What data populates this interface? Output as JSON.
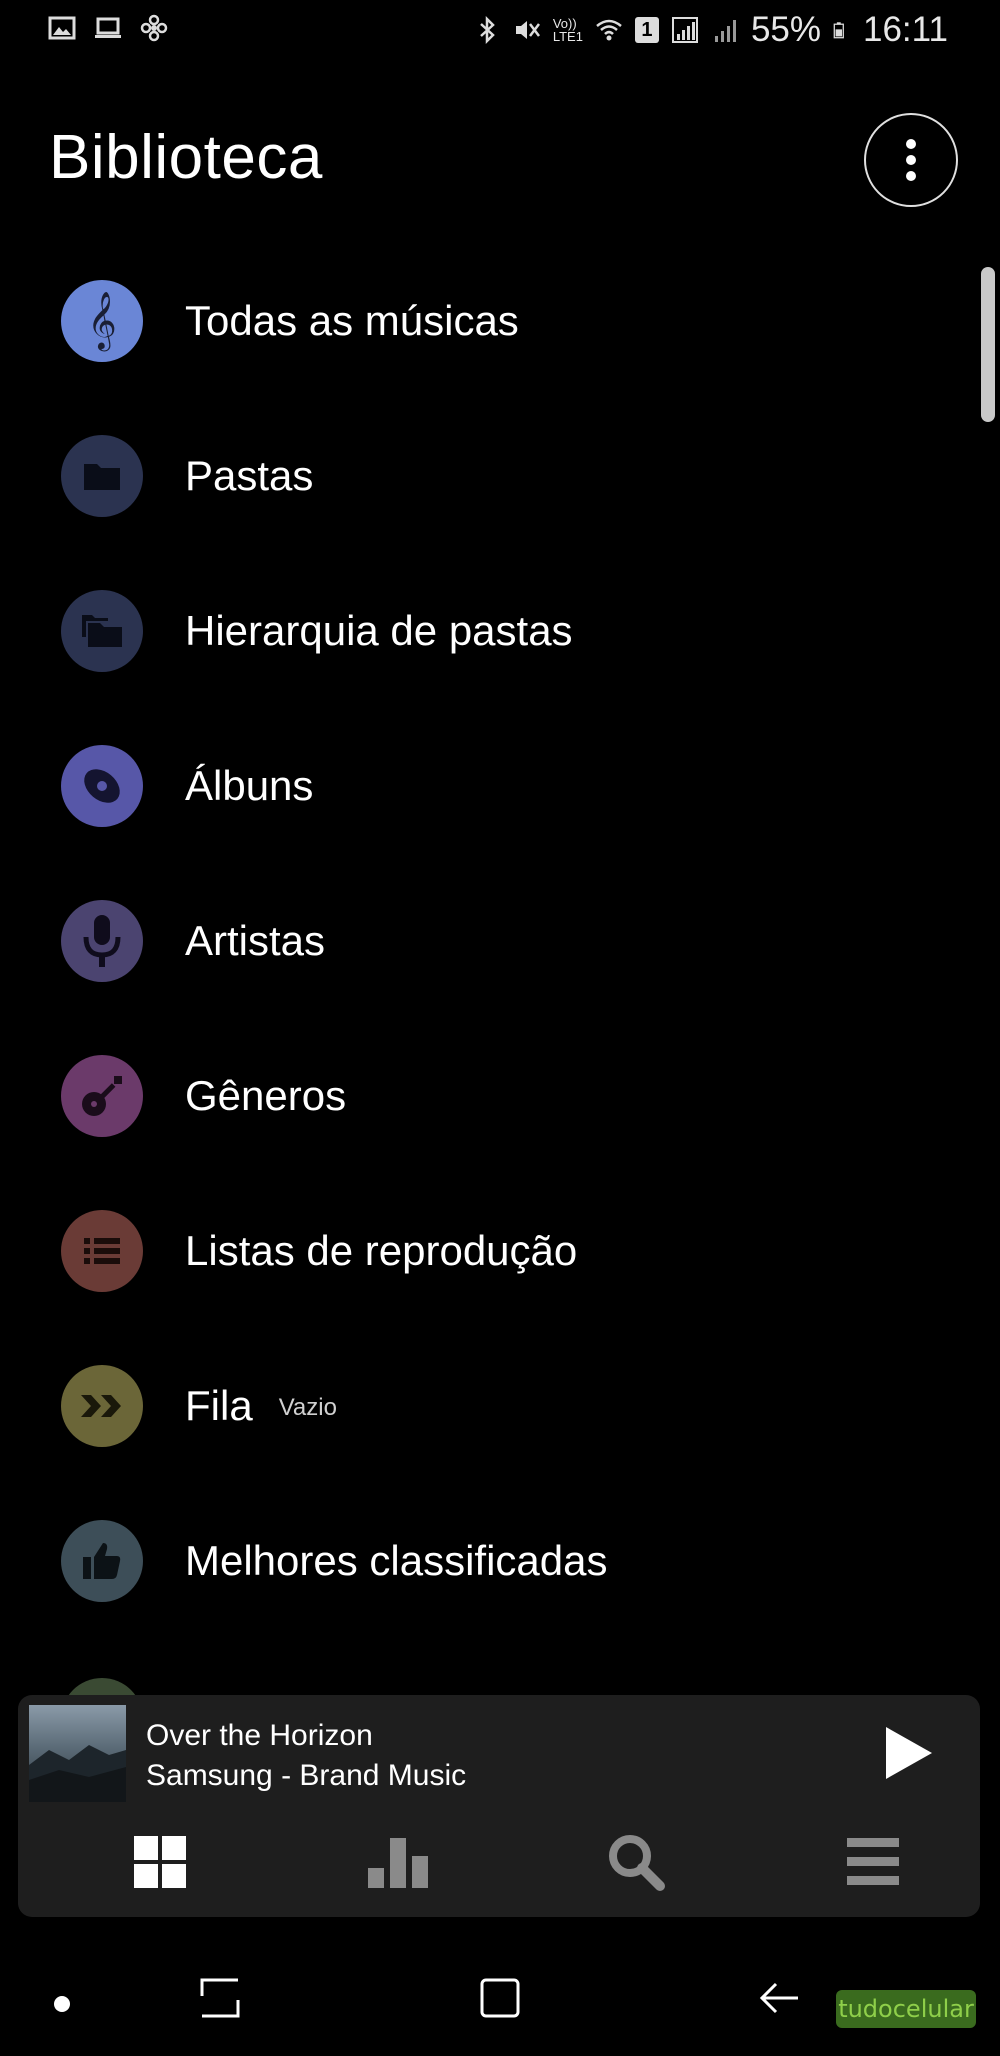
{
  "status_bar": {
    "battery": "55%",
    "time": "16:11",
    "volte_top": "Vo))",
    "volte_bottom": "LTE1",
    "sim": "1"
  },
  "header": {
    "title": "Biblioteca"
  },
  "library_items": [
    {
      "label": "Todas as músicas",
      "icon": "treble-clef-icon",
      "color": "#6a86d6"
    },
    {
      "label": "Pastas",
      "icon": "folder-icon",
      "color": "#2b3350"
    },
    {
      "label": "Hierarquia de pastas",
      "icon": "folder-hierarchy-icon",
      "color": "#2b3350"
    },
    {
      "label": "Álbuns",
      "icon": "album-disc-icon",
      "color": "#5757a8"
    },
    {
      "label": "Artistas",
      "icon": "microphone-icon",
      "color": "#4b4470"
    },
    {
      "label": "Gêneros",
      "icon": "guitar-icon",
      "color": "#6b3a6a"
    },
    {
      "label": "Listas de reprodução",
      "icon": "playlist-icon",
      "color": "#6a3b36"
    },
    {
      "label": "Fila",
      "sub": "Vazio",
      "icon": "queue-icon",
      "color": "#6b6638"
    },
    {
      "label": "Melhores classificadas",
      "icon": "thumbs-up-icon",
      "color": "#3d4e58"
    }
  ],
  "player": {
    "title": "Over the Horizon",
    "artist": "Samsung - Brand Music"
  },
  "nav_tabs": [
    "library-grid-icon",
    "charts-icon",
    "search-icon",
    "menu-icon"
  ],
  "watermark": "tudocelular"
}
